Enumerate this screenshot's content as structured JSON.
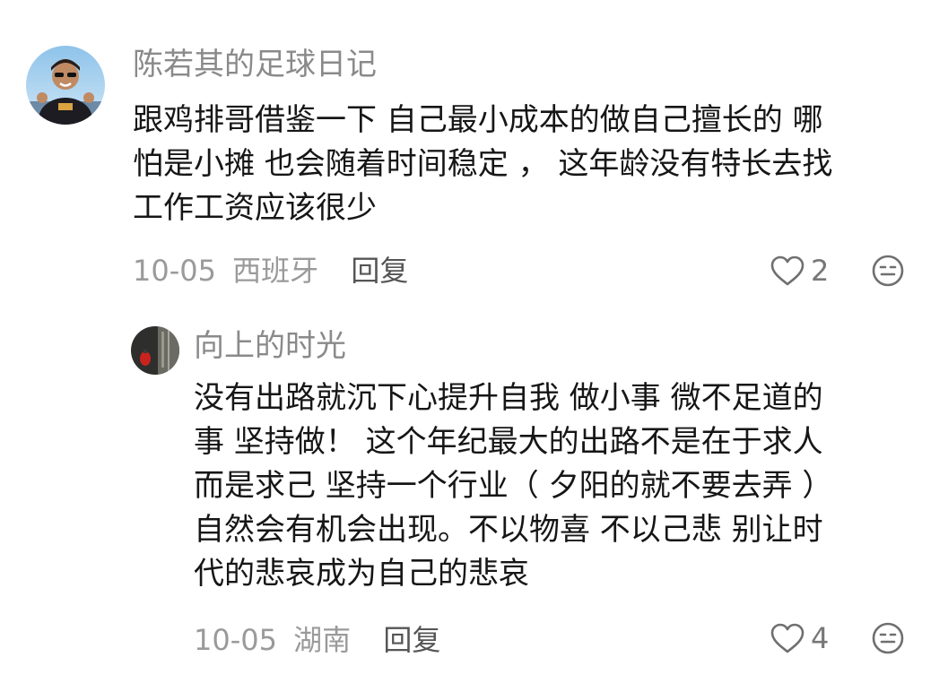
{
  "comments": [
    {
      "username": "陈若其的足球日记",
      "lines": [
        "跟鸡排哥借鉴一下 自己最小成本的做自己擅长的 哪",
        "怕是小摊 也会随着时间稳定 ， 这年龄没有特长去找",
        "工作工资应该很少"
      ],
      "date": "10-05",
      "location": "西班牙",
      "reply_label": "回复",
      "likes": "2",
      "avatar_icon": "user-avatar",
      "like_icon": "heart-outline",
      "dislike_icon": "neutral-face"
    },
    {
      "username": "向上的时光",
      "lines": [
        "没有出路就沉下心提升自我 做小事 微不足道的",
        "事 坚持做！ 这个年纪最大的出路不是在于求人",
        "而是求己 坚持一个行业（ 夕阳的就不要去弄 ）",
        "自然会有机会出现。不以物喜 不以己悲 别让时",
        "代的悲哀成为自己的悲哀"
      ],
      "date": "10-05",
      "location": "湖南",
      "reply_label": "回复",
      "likes": "4",
      "avatar_icon": "user-avatar",
      "like_icon": "heart-outline",
      "dislike_icon": "neutral-face"
    }
  ]
}
